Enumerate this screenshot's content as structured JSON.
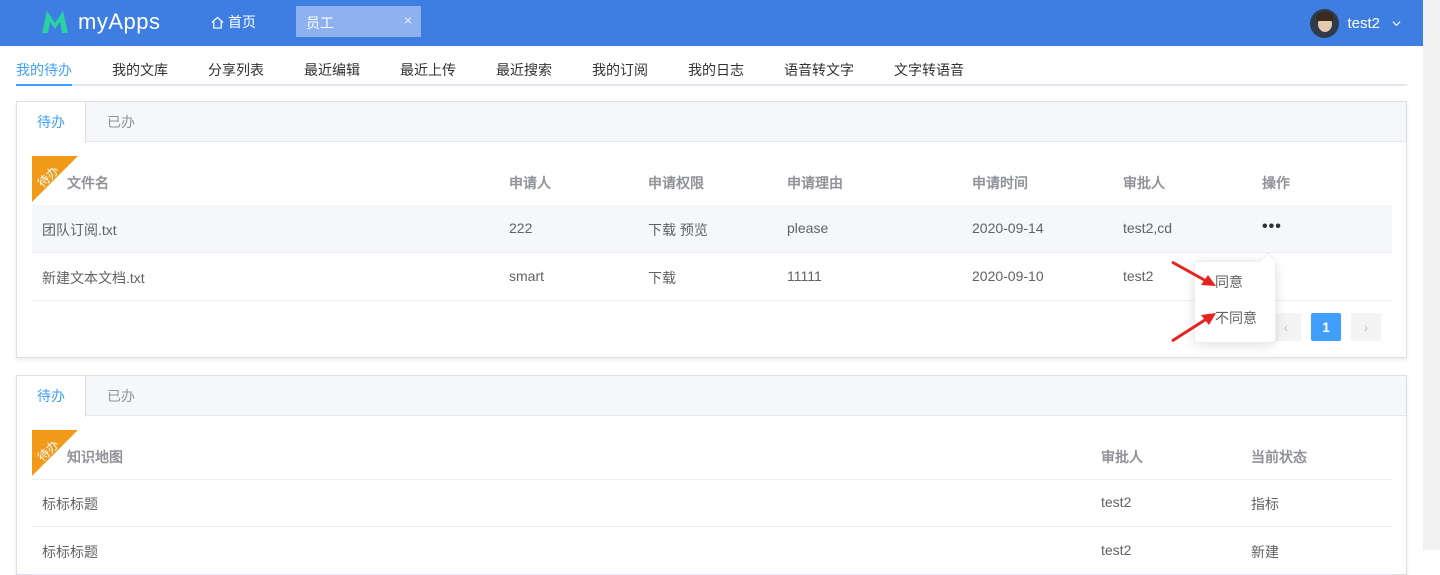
{
  "header": {
    "app_name": "myApps",
    "home_label": "首页",
    "open_tab": "员工",
    "close_symbol": "×",
    "user_name": "test2"
  },
  "nav": {
    "tabs": [
      "我的待办",
      "我的文库",
      "分享列表",
      "最近编辑",
      "最近上传",
      "最近搜索",
      "我的订阅",
      "我的日志",
      "语音转文字",
      "文字转语音"
    ],
    "active": "我的待办"
  },
  "card1": {
    "tabs": [
      "待办",
      "已办"
    ],
    "ribbon": "待办",
    "columns": [
      "文件名",
      "申请人",
      "申请权限",
      "申请理由",
      "申请时间",
      "审批人",
      "操作"
    ],
    "rows": [
      [
        "团队订阅.txt",
        "222",
        "下载 预览",
        "please",
        "2020-09-14",
        "test2,cd"
      ],
      [
        "新建文本文档.txt",
        "smart",
        "下载",
        "11111",
        "2020-09-10",
        "test2"
      ]
    ],
    "more_symbol": "•••",
    "pagination": {
      "prev": "‹",
      "current": "1",
      "next": "›"
    }
  },
  "dropdown": {
    "items": [
      "同意",
      "不同意"
    ]
  },
  "card2": {
    "tabs": [
      "待办",
      "已办"
    ],
    "ribbon": "待办",
    "columns": [
      "知识地图",
      "审批人",
      "当前状态"
    ],
    "rows": [
      [
        "标标标题",
        "test2",
        "指标"
      ],
      [
        "标标标题",
        "test2",
        "新建"
      ]
    ]
  },
  "colors": {
    "header_bg": "#3e7ee3",
    "accent": "#409eff",
    "ribbon": "#f19a1a",
    "annotation_arrow": "#e8231f"
  }
}
